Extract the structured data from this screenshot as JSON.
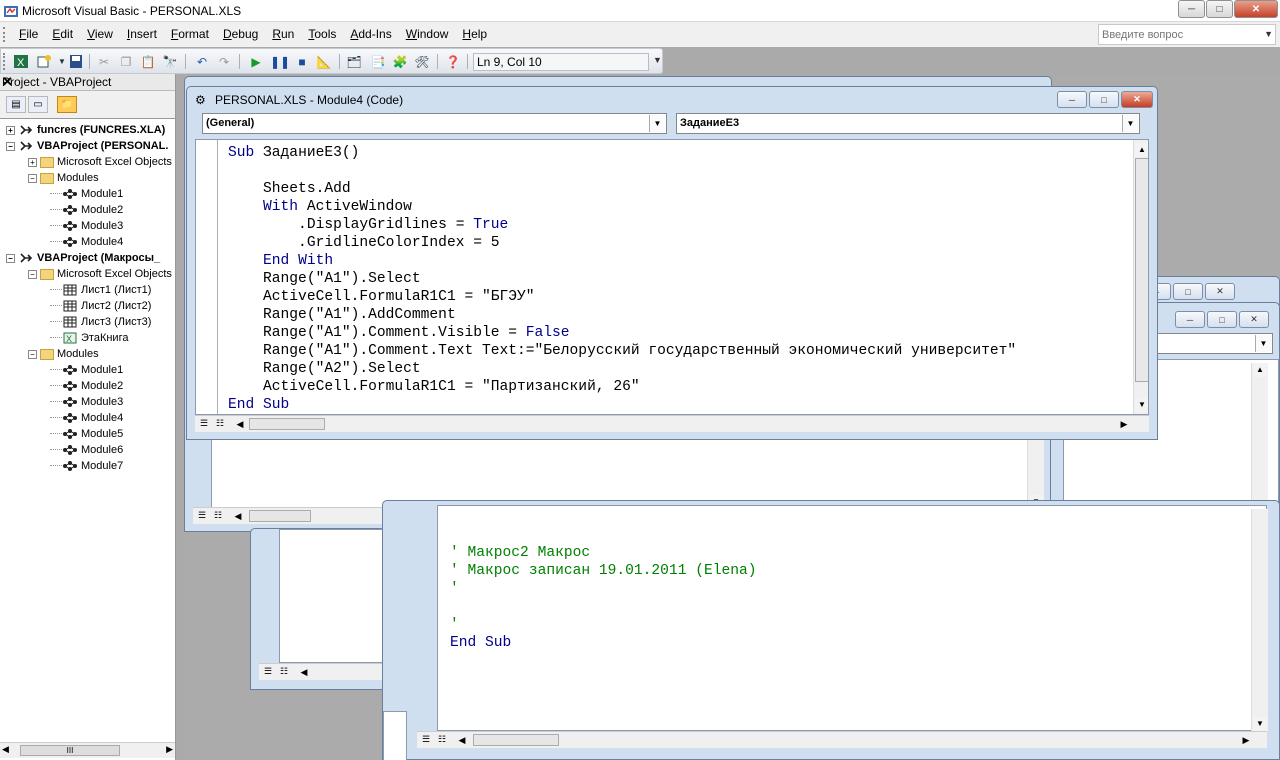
{
  "window": {
    "title": "Microsoft Visual Basic - PERSONAL.XLS",
    "min": "─",
    "max": "□",
    "close": "✕"
  },
  "menu": [
    "File",
    "Edit",
    "View",
    "Insert",
    "Format",
    "Debug",
    "Run",
    "Tools",
    "Add-Ins",
    "Window",
    "Help"
  ],
  "help": {
    "placeholder": "Введите вопрос"
  },
  "toolbar": {
    "position": "Ln 9, Col 10"
  },
  "project": {
    "title": "Project - VBAProject",
    "close": "✕",
    "nodes": [
      {
        "label": "funcres (FUNCRES.XLA)",
        "level": 0,
        "exp": "+",
        "icon": "vba",
        "bold": true
      },
      {
        "label": "VBAProject (PERSONAL.",
        "level": 0,
        "exp": "−",
        "icon": "vba",
        "bold": true
      },
      {
        "label": "Microsoft Excel Objects",
        "level": 1,
        "exp": "+",
        "icon": "folder"
      },
      {
        "label": "Modules",
        "level": 1,
        "exp": "−",
        "icon": "folder"
      },
      {
        "label": "Module1",
        "level": 2,
        "icon": "module"
      },
      {
        "label": "Module2",
        "level": 2,
        "icon": "module"
      },
      {
        "label": "Module3",
        "level": 2,
        "icon": "module"
      },
      {
        "label": "Module4",
        "level": 2,
        "icon": "module"
      },
      {
        "label": "VBAProject (Макросы_",
        "level": 0,
        "exp": "−",
        "icon": "vba",
        "bold": true
      },
      {
        "label": "Microsoft Excel Objects",
        "level": 1,
        "exp": "−",
        "icon": "folder"
      },
      {
        "label": "Лист1 (Лист1)",
        "level": 2,
        "icon": "sheet"
      },
      {
        "label": "Лист2 (Лист2)",
        "level": 2,
        "icon": "sheet"
      },
      {
        "label": "Лист3 (Лист3)",
        "level": 2,
        "icon": "sheet"
      },
      {
        "label": "ЭтаКнига",
        "level": 2,
        "icon": "book"
      },
      {
        "label": "Modules",
        "level": 1,
        "exp": "−",
        "icon": "folder"
      },
      {
        "label": "Module1",
        "level": 2,
        "icon": "module"
      },
      {
        "label": "Module2",
        "level": 2,
        "icon": "module"
      },
      {
        "label": "Module3",
        "level": 2,
        "icon": "module"
      },
      {
        "label": "Module4",
        "level": 2,
        "icon": "module"
      },
      {
        "label": "Module5",
        "level": 2,
        "icon": "module"
      },
      {
        "label": "Module6",
        "level": 2,
        "icon": "module"
      },
      {
        "label": "Module7",
        "level": 2,
        "icon": "module"
      }
    ]
  },
  "codewin": {
    "title": "PERSONAL.XLS - Module4 (Code)",
    "object": "(General)",
    "procedure": "ЗаданиеЕ3",
    "lines": [
      "Sub ЗаданиеЕ3()",
      "",
      "    Sheets.Add",
      "    With ActiveWindow",
      "        .DisplayGridlines = True",
      "        .GridlineColorIndex = 5",
      "    End With",
      "    Range(\"A1\").Select",
      "    ActiveCell.FormulaR1C1 = \"БГЭУ\"",
      "    Range(\"A1\").AddComment",
      "    Range(\"A1\").Comment.Visible = False",
      "    Range(\"A1\").Comment.Text Text:=\"Белорусский государственный экономический университет\"",
      "    Range(\"A2\").Select",
      "    ActiveCell.FormulaR1C1 = \"Партизанский, 26\"",
      "End Sub"
    ]
  },
  "backwin": {
    "lines": [
      "' Макрос2 Макрос",
      "' Макрос записан 19.01.2011 (Elena)",
      "'",
      "",
      "'",
      "End Sub"
    ]
  },
  "colors": {
    "keyword": "#00008b",
    "comment": "#008000"
  }
}
